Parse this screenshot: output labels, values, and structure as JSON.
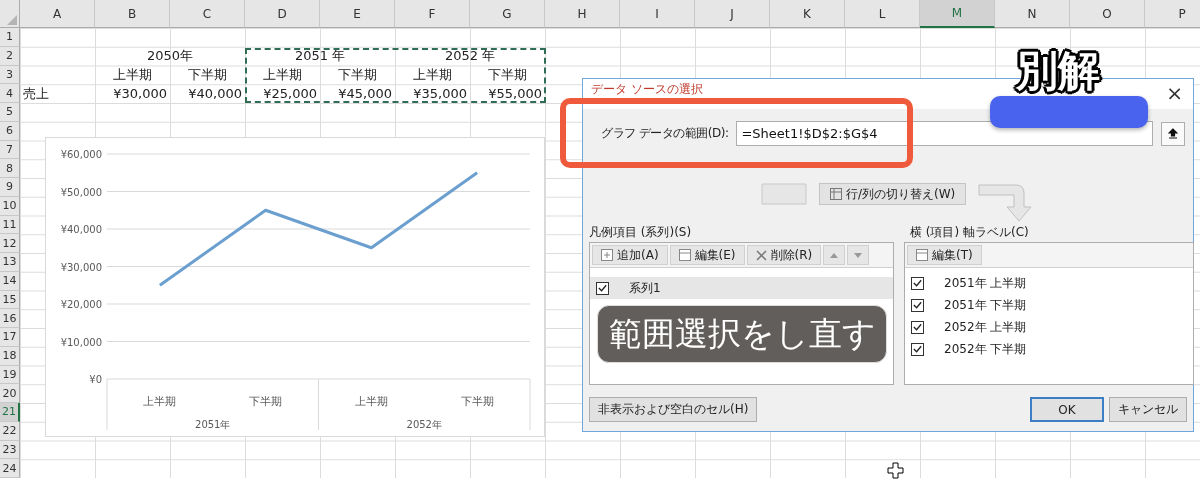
{
  "sheet": {
    "columns": [
      {
        "label": "A",
        "selected": false
      },
      {
        "label": "B",
        "selected": false
      },
      {
        "label": "C",
        "selected": false
      },
      {
        "label": "D",
        "selected": false
      },
      {
        "label": "E",
        "selected": false
      },
      {
        "label": "F",
        "selected": false
      },
      {
        "label": "G",
        "selected": false
      },
      {
        "label": "H",
        "selected": false
      },
      {
        "label": "I",
        "selected": false
      },
      {
        "label": "J",
        "selected": false
      },
      {
        "label": "K",
        "selected": false
      },
      {
        "label": "L",
        "selected": false
      },
      {
        "label": "M",
        "selected": true
      },
      {
        "label": "N",
        "selected": false
      },
      {
        "label": "O",
        "selected": false
      },
      {
        "label": "P",
        "selected": false
      }
    ],
    "rows": [
      {
        "label": "1",
        "selected": false
      },
      {
        "label": "2",
        "selected": false
      },
      {
        "label": "3",
        "selected": false
      },
      {
        "label": "4",
        "selected": false
      },
      {
        "label": "5",
        "selected": false
      },
      {
        "label": "6",
        "selected": false
      },
      {
        "label": "7",
        "selected": false
      },
      {
        "label": "8",
        "selected": false
      },
      {
        "label": "9",
        "selected": false
      },
      {
        "label": "10",
        "selected": false
      },
      {
        "label": "11",
        "selected": false
      },
      {
        "label": "12",
        "selected": false
      },
      {
        "label": "13",
        "selected": false
      },
      {
        "label": "14",
        "selected": false
      },
      {
        "label": "15",
        "selected": false
      },
      {
        "label": "16",
        "selected": false
      },
      {
        "label": "17",
        "selected": false
      },
      {
        "label": "18",
        "selected": false
      },
      {
        "label": "19",
        "selected": false
      },
      {
        "label": "20",
        "selected": false
      },
      {
        "label": "21",
        "selected": true
      },
      {
        "label": "22",
        "selected": false
      },
      {
        "label": "23",
        "selected": false
      },
      {
        "label": "24",
        "selected": false
      }
    ],
    "year_groups": [
      "2050年",
      "2051 年",
      "2052 年"
    ],
    "halves": [
      "上半期",
      "下半期",
      "上半期",
      "下半期",
      "上半期",
      "下半期"
    ],
    "row_label": "売上",
    "values": [
      "¥30,000",
      "¥40,000",
      "¥25,000",
      "¥45,000",
      "¥35,000",
      "¥55,000"
    ]
  },
  "chart": {
    "chart_data": {
      "type": "line",
      "categories": [
        "上半期",
        "下半期",
        "上半期",
        "下半期"
      ],
      "series": [
        {
          "color": "#6b9fcf",
          "values": [
            25000,
            45000,
            35000,
            55000
          ]
        }
      ],
      "ylim": [
        0,
        60000
      ],
      "grid": true,
      "yticks": [
        {
          "value": 0,
          "label": "¥0"
        },
        {
          "value": 10000,
          "label": "¥10,000"
        },
        {
          "value": 20000,
          "label": "¥20,000"
        },
        {
          "value": 30000,
          "label": "¥30,000"
        },
        {
          "value": 40000,
          "label": "¥40,000"
        },
        {
          "value": 50000,
          "label": "¥50,000"
        },
        {
          "value": 60000,
          "label": "¥60,000"
        }
      ]
    },
    "category_groups": [
      "2051年",
      "2052年"
    ]
  },
  "dialog": {
    "title": "データ ソースの選択",
    "close": "×",
    "range_label": "グラフ データの範囲(D):",
    "range_value": "=Sheet1!$D$2:$G$4",
    "switch_button": "行/列の切り替え(W)",
    "series_label": "凡例項目 (系列)(S)",
    "series_tools": [
      "追加(A)",
      "編集(E)",
      "削除(R)"
    ],
    "series": [
      {
        "label": "系列1",
        "checked": true,
        "selected": true
      }
    ],
    "axis_label_title": "横 (項目) 軸ラベル(C)",
    "axis_tool": "編集(T)",
    "axis_items": [
      {
        "label": "2051年 上半期",
        "checked": true
      },
      {
        "label": "2051年 下半期",
        "checked": true
      },
      {
        "label": "2052年 上半期",
        "checked": true
      },
      {
        "label": "2052年 下半期",
        "checked": true
      }
    ],
    "hidden_cells_button": "非表示および空白のセル(H)",
    "ok_button": "OK",
    "cancel_button": "キャンセル"
  },
  "annotations": {
    "caption": "範囲選択をし直す",
    "badge": "別解"
  }
}
